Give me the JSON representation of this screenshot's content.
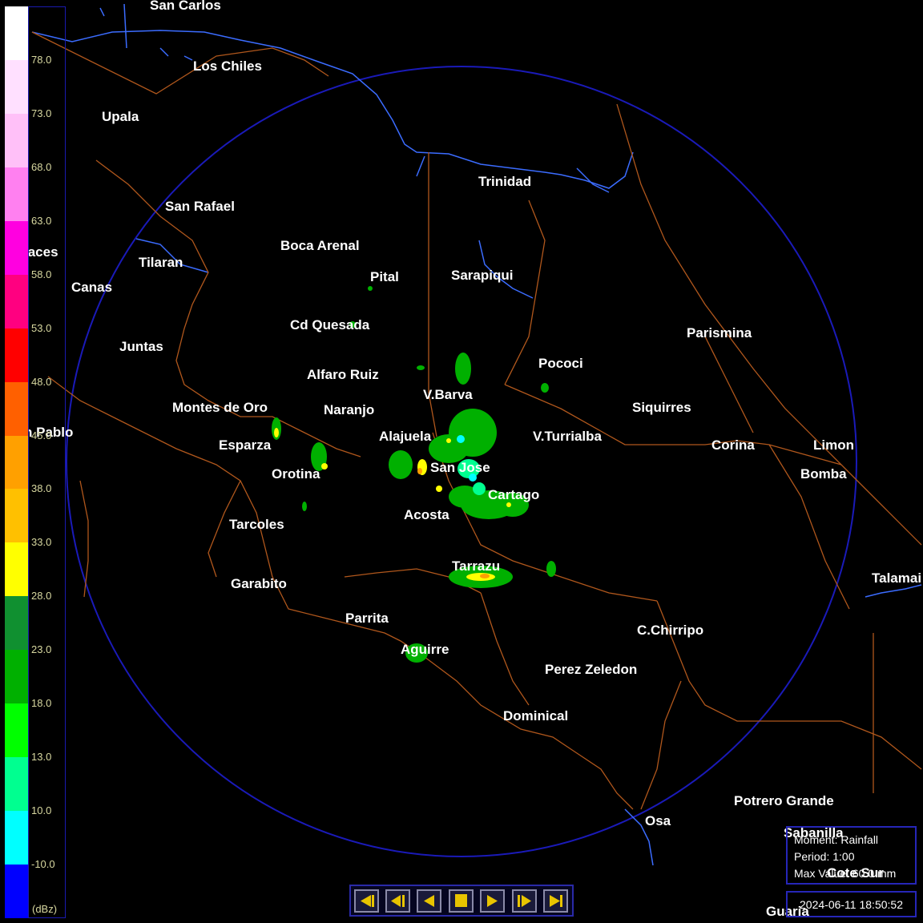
{
  "radar": {
    "moment_label": "Moment: Rainfall",
    "period_label": "Period: 1:00",
    "max_value_label": "Max Value: 60.0 mm",
    "timestamp": "2024-06-11 18:50:52"
  },
  "scale": {
    "unit": "(dBz)",
    "labels": [
      "78.0",
      "73.0",
      "68.0",
      "63.0",
      "58.0",
      "53.0",
      "48.0",
      "45.0",
      "38.0",
      "33.0",
      "28.0",
      "23.0",
      "18.0",
      "13.0",
      "10.0",
      "-10.0"
    ],
    "colors": [
      "#ffffff",
      "#ffe0ff",
      "#ffc0f8",
      "#ff80f0",
      "#ff00e0",
      "#ff0080",
      "#ff0000",
      "#ff6000",
      "#ffa000",
      "#ffc000",
      "#ffff00",
      "#109030",
      "#00b000",
      "#00ff00",
      "#00ff90",
      "#00ffff",
      "#0000ff"
    ]
  },
  "places": {
    "san_carlos": "San Carlos",
    "los_chiles": "Los Chiles",
    "upala": "Upala",
    "trinidad": "Trinidad",
    "san_rafael": "San Rafael",
    "boca_arenal": "Boca Arenal",
    "tilaran": "Tilaran",
    "pital": "Pital",
    "sarapiqui": "Sarapiqui",
    "canas": "Canas",
    "bagaces": "jaces",
    "parismina": "Parismina",
    "cd_quesada": "Cd Quesada",
    "juntas": "Juntas",
    "alfaro_ruiz": "Alfaro Ruiz",
    "pococi": "Pococi",
    "v_barva": "V.Barva",
    "montes_de_oro": "Montes de Oro",
    "naranjo": "Naranjo",
    "siquirres": "Siquirres",
    "san_pablo": "n Pablo",
    "alajuela": "Alajuela",
    "v_turrialba": "V.Turrialba",
    "esparza": "Esparza",
    "corina": "Corina",
    "limon": "Limon",
    "san_jose": "San Jose",
    "orotina": "Orotina",
    "bomba": "Bomba",
    "cartago": "Cartago",
    "acosta": "Acosta",
    "tarcoles": "Tarcoles",
    "tarrazu": "Tarrazu",
    "talamanca": "Talamai",
    "garabito": "Garabito",
    "parrita": "Parrita",
    "c_chirripo": "C.Chirripo",
    "aguirre": "Aguirre",
    "perez_zeledon": "Perez Zeledon",
    "dominical": "Dominical",
    "potrero_grande": "Potrero Grande",
    "osa": "Osa",
    "sabanilla": "Sabanilla",
    "cote_sur": "Cote Sur",
    "guaria": "Guaria"
  },
  "player": {
    "buttons": [
      "first-frame",
      "step-back",
      "play-reverse",
      "stop",
      "play-forward",
      "step-forward",
      "last-frame"
    ]
  }
}
